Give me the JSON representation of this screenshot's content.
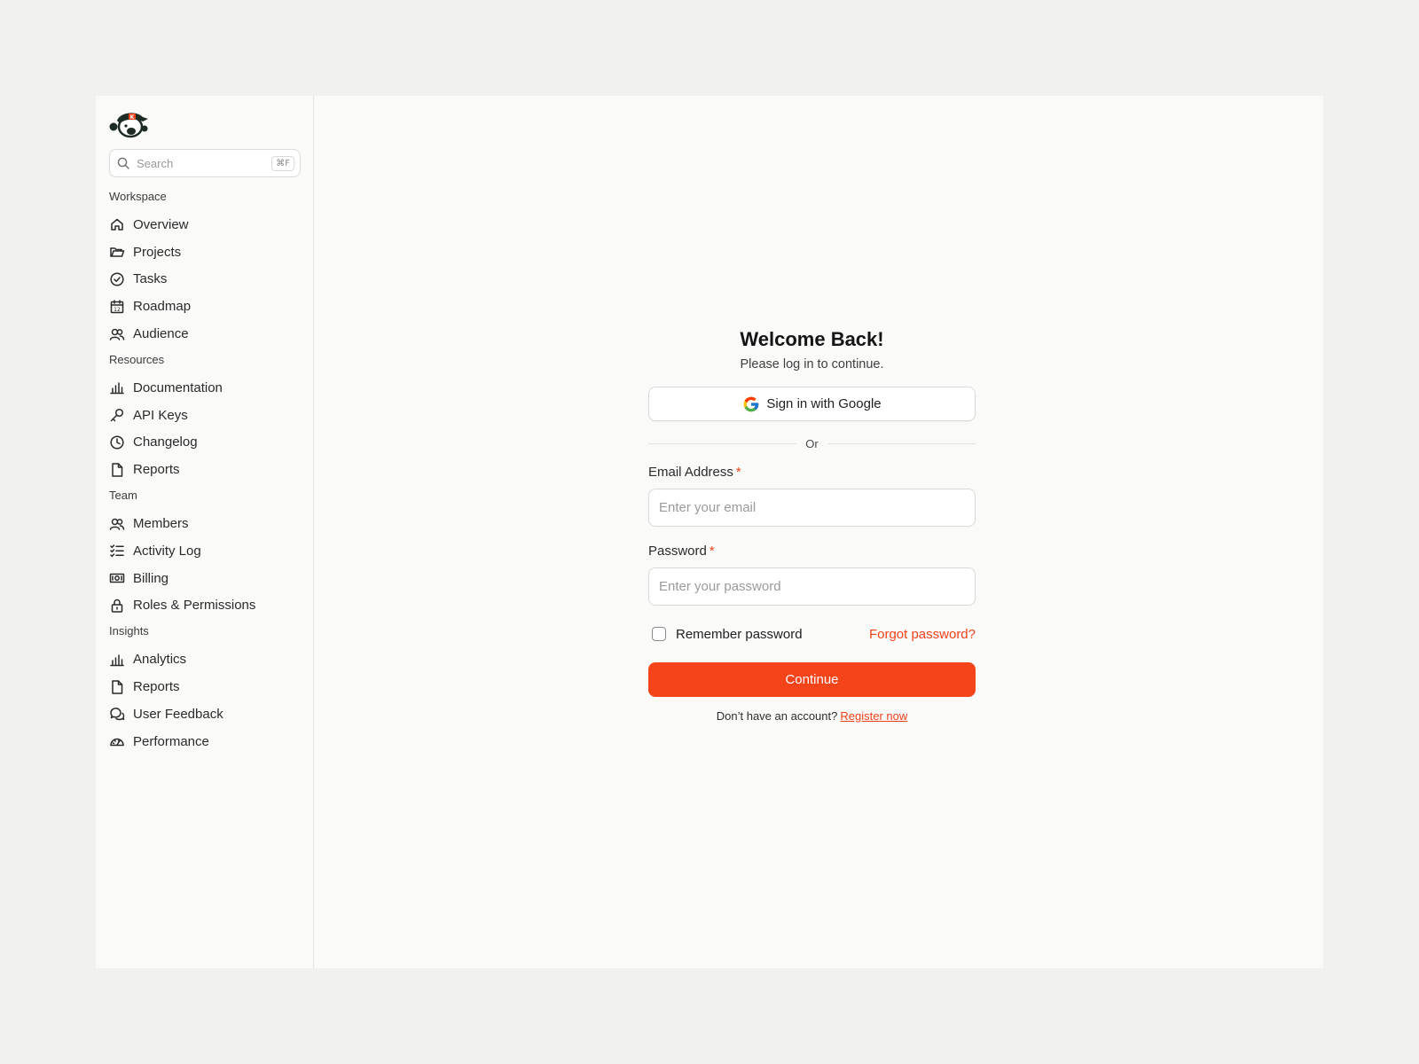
{
  "sidebar": {
    "search_placeholder": "Search",
    "search_shortcut": "⌘F",
    "sections": [
      {
        "title": "Workspace",
        "items": [
          {
            "label": "Overview",
            "icon": "home-icon"
          },
          {
            "label": "Projects",
            "icon": "folder-icon"
          },
          {
            "label": "Tasks",
            "icon": "check-circle-icon"
          },
          {
            "label": "Roadmap",
            "icon": "calendar-icon"
          },
          {
            "label": "Audience",
            "icon": "users-icon"
          }
        ]
      },
      {
        "title": "Resources",
        "items": [
          {
            "label": "Documentation",
            "icon": "bar-chart-icon"
          },
          {
            "label": "API Keys",
            "icon": "key-icon"
          },
          {
            "label": "Changelog",
            "icon": "clock-icon"
          },
          {
            "label": "Reports",
            "icon": "file-icon"
          }
        ]
      },
      {
        "title": "Team",
        "items": [
          {
            "label": "Members",
            "icon": "users-icon"
          },
          {
            "label": "Activity Log",
            "icon": "list-check-icon"
          },
          {
            "label": "Billing",
            "icon": "banknote-icon"
          },
          {
            "label": "Roles & Permissions",
            "icon": "lock-icon"
          }
        ]
      },
      {
        "title": "Insights",
        "items": [
          {
            "label": "Analytics",
            "icon": "bar-chart-icon"
          },
          {
            "label": "Reports",
            "icon": "file-icon"
          },
          {
            "label": "User Feedback",
            "icon": "chat-icon"
          },
          {
            "label": "Performance",
            "icon": "gauge-icon"
          }
        ]
      }
    ]
  },
  "login": {
    "title": "Welcome Back!",
    "subtitle": "Please log in to continue.",
    "google_button": "Sign in with Google",
    "divider": "Or",
    "email_label": "Email Address",
    "email_placeholder": "Enter your email",
    "password_label": "Password",
    "password_placeholder": "Enter your password",
    "required_mark": "*",
    "remember_label": "Remember password",
    "forgot_link": "Forgot password?",
    "continue_button": "Continue",
    "register_prompt": "Don’t have an account?",
    "register_link": "Register now"
  },
  "colors": {
    "accent": "#f5431a",
    "background": "#f1f1f0",
    "panel": "#fafaf9"
  }
}
